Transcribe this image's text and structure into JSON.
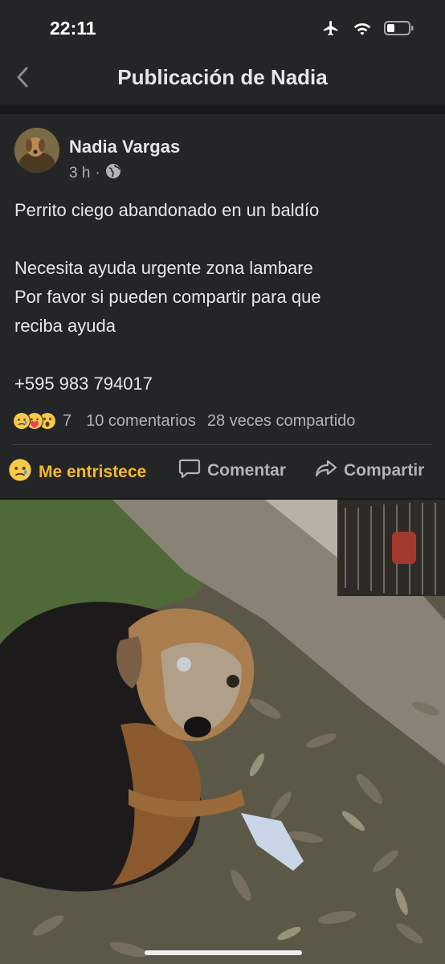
{
  "status": {
    "time": "22:11",
    "icons": [
      "airplane-icon",
      "wifi-icon",
      "battery-icon"
    ]
  },
  "nav": {
    "title": "Publicación de Nadia",
    "back_icon": "chevron-left-icon"
  },
  "post": {
    "author": "Nadia Vargas",
    "time": "3 h",
    "separator": "·",
    "privacy_icon": "globe-icon",
    "text_lines": [
      "Perrito ciego abandonado en un baldío",
      "",
      "Necesita ayuda urgente zona lambare",
      "Por favor si pueden compartir para que",
      "reciba ayuda",
      "",
      "+595 983 794017"
    ],
    "reactions": {
      "emoji_icons": [
        "sad-face-icon",
        "care-face-icon",
        "wow-face-icon"
      ],
      "count": "7",
      "comments": "10 comentarios",
      "shares": "28 veces compartido"
    },
    "actions": {
      "reaction_label": "Me entristece",
      "comment_label": "Comentar",
      "share_label": "Compartir"
    }
  },
  "colors": {
    "background": "#18191a",
    "surface": "#242526",
    "text_primary": "#e4e6eb",
    "text_secondary": "#b0b3b8",
    "sad_reaction": "#f7b928"
  }
}
